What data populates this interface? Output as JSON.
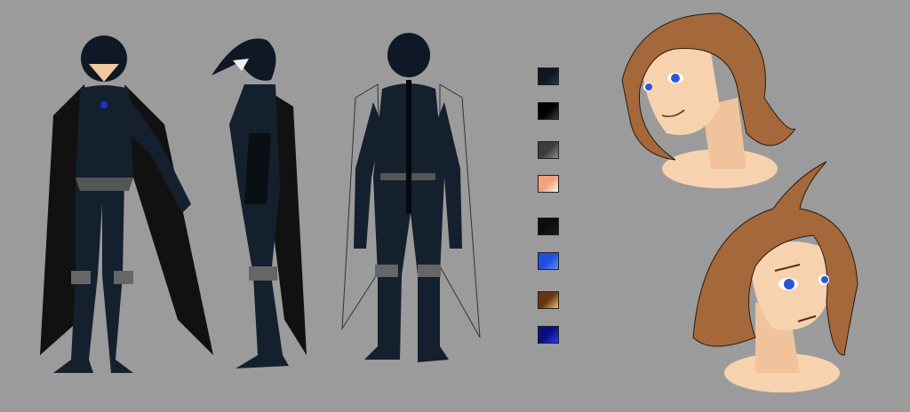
{
  "background_color": "#9b9b9b",
  "figures": [
    {
      "view": "front",
      "icon": "costumed-figure-front"
    },
    {
      "view": "side",
      "icon": "costumed-figure-side"
    },
    {
      "view": "back",
      "icon": "costumed-figure-back"
    }
  ],
  "portraits": [
    {
      "expression": "smiling",
      "icon": "portrait-smiling"
    },
    {
      "expression": "angry",
      "icon": "portrait-angry"
    }
  ],
  "palette": [
    {
      "from": "#0e1722",
      "to": "#26374a"
    },
    {
      "from": "#000000",
      "to": "#3a3a3a"
    },
    {
      "from": "#3c3c3c",
      "to": "#8a8a8a"
    },
    {
      "from": "#f3a27c",
      "to": "#fff6ea"
    },
    {
      "from": "#0d0d0d",
      "to": "#1a1a1a"
    },
    {
      "from": "#1e4fe0",
      "to": "#5a8cff"
    },
    {
      "from": "#6a3414",
      "to": "#f2c26a"
    },
    {
      "from": "#0a0f80",
      "to": "#2a3cff"
    }
  ]
}
